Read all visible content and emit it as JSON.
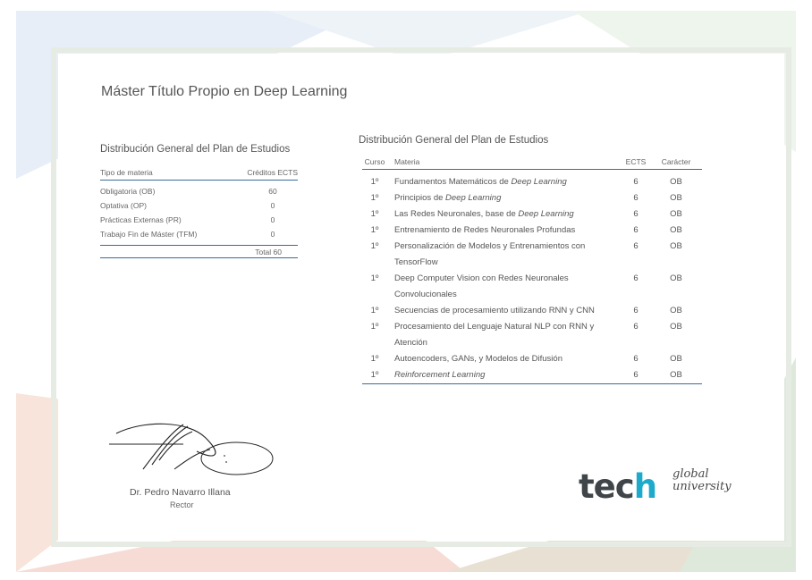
{
  "certificate": {
    "title": "Máster Título Propio en Deep Learning",
    "summary_table": {
      "heading": "Distribución General del Plan de Estudios",
      "col_type": "Tipo de materia",
      "col_credits": "Créditos ECTS",
      "rows": [
        {
          "type": "Obligatoria (OB)",
          "credits": "60"
        },
        {
          "type": "Optativa (OP)",
          "credits": "0"
        },
        {
          "type": "Prácticas Externas (PR)",
          "credits": "0"
        },
        {
          "type": "Trabajo Fin de Máster (TFM)",
          "credits": "0"
        }
      ],
      "total": "Total 60"
    },
    "detail_table": {
      "heading": "Distribución General del Plan de Estudios",
      "col_course": "Curso",
      "col_subject": "Materia",
      "col_ects": "ECTS",
      "col_type": "Carácter",
      "rows": [
        {
          "course": "1º",
          "subject": "Fundamentos Matemáticos de Deep Learning",
          "ects": "6",
          "type": "OB"
        },
        {
          "course": "1º",
          "subject": "Principios de Deep Learning",
          "ects": "6",
          "type": "OB"
        },
        {
          "course": "1º",
          "subject": "Las Redes Neuronales, base de Deep Learning",
          "ects": "6",
          "type": "OB"
        },
        {
          "course": "1º",
          "subject": "Entrenamiento de Redes Neuronales Profundas",
          "ects": "6",
          "type": "OB"
        },
        {
          "course": "1º",
          "subject": "Personalización de Modelos y Entrenamientos con TensorFlow",
          "ects": "6",
          "type": "OB"
        },
        {
          "course": "1º",
          "subject": "Deep Computer Vision con Redes Neuronales Convolucionales",
          "ects": "6",
          "type": "OB"
        },
        {
          "course": "1º",
          "subject": "Secuencias de procesamiento utilizando RNN y CNN",
          "ects": "6",
          "type": "OB"
        },
        {
          "course": "1º",
          "subject": "Procesamiento del Lenguaje Natural NLP con RNN y Atención",
          "ects": "6",
          "type": "OB"
        },
        {
          "course": "1º",
          "subject": "Autoencoders, GANs, y Modelos de Difusión",
          "ects": "6",
          "type": "OB"
        },
        {
          "course": "1º",
          "subject": "Reinforcement Learning",
          "ects": "6",
          "type": "OB"
        }
      ]
    },
    "signatory_name": "Dr. Pedro Navarro Illana",
    "signatory_role": "Rector",
    "logo_text": "tech",
    "logo_sub1": "global",
    "logo_sub2": "university"
  }
}
